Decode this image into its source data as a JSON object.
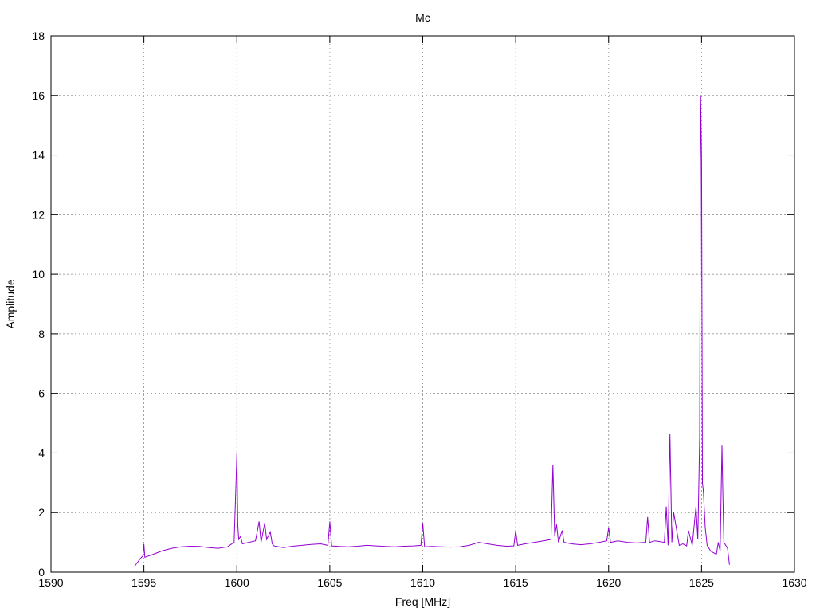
{
  "chart_data": {
    "type": "line",
    "title": "Mc",
    "xlabel": "Freq [MHz]",
    "ylabel": "Amplitude",
    "xlim": [
      1590,
      1630
    ],
    "ylim": [
      0,
      18
    ],
    "xticks": [
      1590,
      1595,
      1600,
      1605,
      1610,
      1615,
      1620,
      1625,
      1630
    ],
    "yticks": [
      0,
      2,
      4,
      6,
      8,
      10,
      12,
      14,
      16,
      18
    ],
    "grid": true,
    "legend": "none",
    "series_color": "#9400d3",
    "series": [
      {
        "x": [
          1594.5,
          1594.8,
          1594.95,
          1595.0,
          1595.05,
          1595.5,
          1596.0,
          1596.5,
          1597.0,
          1597.5,
          1598.0,
          1598.5,
          1599.0,
          1599.5,
          1599.85,
          1599.95,
          1600.0,
          1600.05,
          1600.1,
          1600.2,
          1600.3,
          1600.5,
          1601.0,
          1601.2,
          1601.3,
          1601.5,
          1601.6,
          1601.8,
          1601.9,
          1602.0,
          1602.5,
          1603.0,
          1603.5,
          1604.0,
          1604.5,
          1604.9,
          1605.0,
          1605.1,
          1605.5,
          1606.0,
          1606.5,
          1607.0,
          1607.5,
          1608.0,
          1608.5,
          1609.0,
          1609.5,
          1609.9,
          1610.0,
          1610.1,
          1610.5,
          1611.0,
          1611.5,
          1612.0,
          1612.5,
          1613.0,
          1613.5,
          1614.0,
          1614.5,
          1614.9,
          1615.0,
          1615.1,
          1615.5,
          1616.0,
          1616.5,
          1616.9,
          1617.0,
          1617.1,
          1617.2,
          1617.3,
          1617.5,
          1617.6,
          1618.0,
          1618.5,
          1619.0,
          1619.5,
          1619.9,
          1620.0,
          1620.1,
          1620.5,
          1621.0,
          1621.5,
          1622.0,
          1622.1,
          1622.2,
          1622.5,
          1623.0,
          1623.1,
          1623.2,
          1623.3,
          1623.4,
          1623.5,
          1623.8,
          1624.0,
          1624.2,
          1624.3,
          1624.5,
          1624.7,
          1624.8,
          1624.9,
          1624.95,
          1625.0,
          1625.05,
          1625.1,
          1625.2,
          1625.3,
          1625.5,
          1625.8,
          1625.9,
          1626.0,
          1626.1,
          1626.15,
          1626.2,
          1626.4,
          1626.5
        ],
        "y": [
          0.2,
          0.45,
          0.55,
          0.95,
          0.5,
          0.6,
          0.72,
          0.8,
          0.85,
          0.87,
          0.86,
          0.82,
          0.8,
          0.85,
          1.0,
          2.9,
          4.0,
          1.6,
          1.1,
          1.2,
          0.95,
          0.98,
          1.05,
          1.7,
          1.0,
          1.65,
          1.1,
          1.35,
          0.95,
          0.88,
          0.82,
          0.87,
          0.9,
          0.93,
          0.95,
          0.9,
          1.7,
          0.88,
          0.86,
          0.85,
          0.87,
          0.9,
          0.88,
          0.86,
          0.85,
          0.87,
          0.88,
          0.9,
          1.65,
          0.85,
          0.86,
          0.85,
          0.84,
          0.85,
          0.9,
          1.0,
          0.95,
          0.9,
          0.87,
          0.88,
          1.4,
          0.9,
          0.95,
          1.0,
          1.05,
          1.1,
          3.6,
          1.2,
          1.6,
          1.0,
          1.4,
          1.0,
          0.95,
          0.92,
          0.95,
          1.0,
          1.05,
          1.5,
          1.0,
          1.05,
          1.0,
          0.98,
          1.0,
          1.85,
          1.0,
          1.05,
          1.0,
          2.2,
          0.9,
          4.65,
          1.0,
          2.0,
          0.9,
          0.95,
          0.88,
          1.4,
          0.9,
          2.2,
          1.1,
          4.5,
          16.0,
          13.8,
          3.0,
          2.7,
          1.5,
          0.9,
          0.7,
          0.6,
          1.0,
          0.7,
          4.25,
          2.5,
          1.0,
          0.8,
          0.25
        ]
      }
    ]
  }
}
